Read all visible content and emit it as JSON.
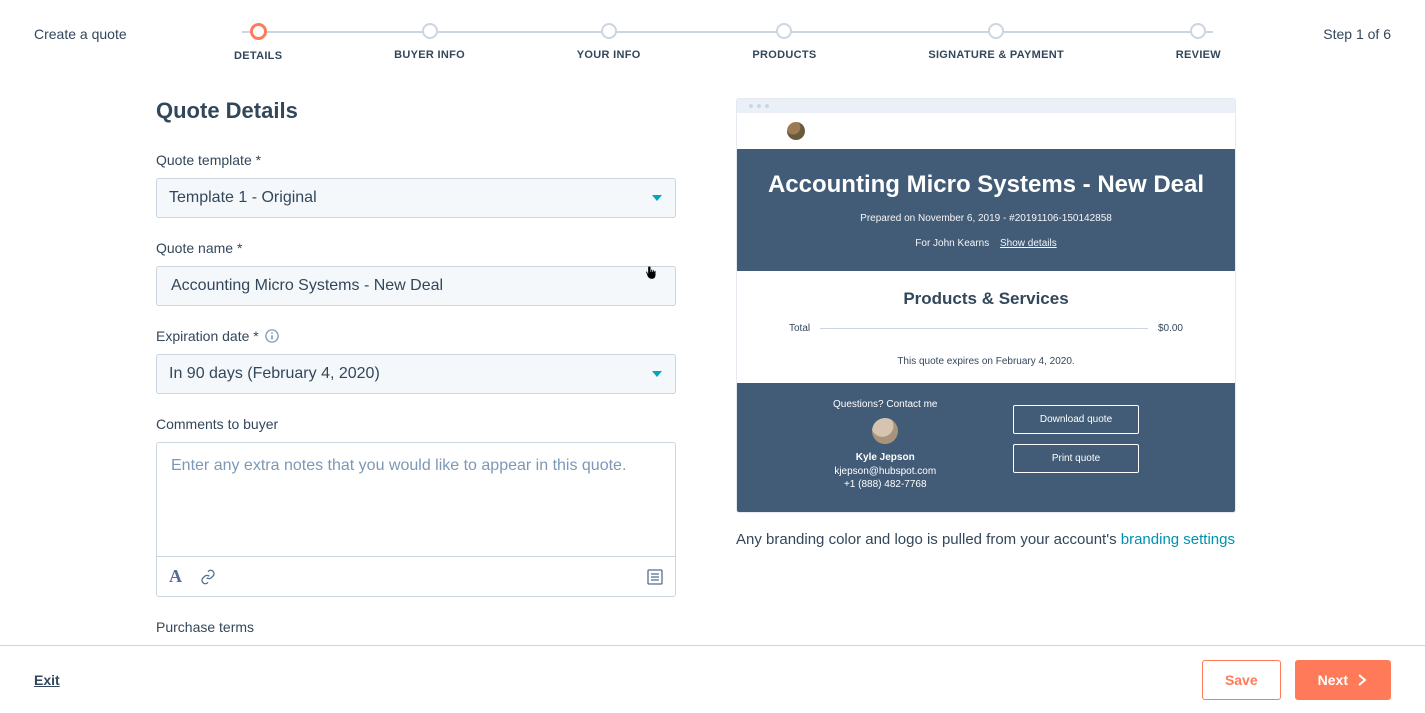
{
  "header": {
    "title": "Create a quote",
    "step_indicator": "Step 1 of 6",
    "steps": [
      {
        "label": "DETAILS",
        "active": true
      },
      {
        "label": "BUYER INFO",
        "active": false
      },
      {
        "label": "YOUR INFO",
        "active": false
      },
      {
        "label": "PRODUCTS",
        "active": false
      },
      {
        "label": "SIGNATURE & PAYMENT",
        "active": false
      },
      {
        "label": "REVIEW",
        "active": false
      }
    ]
  },
  "form": {
    "section_title": "Quote Details",
    "template_label": "Quote template *",
    "template_value": "Template 1 - Original",
    "name_label": "Quote name *",
    "name_value": "Accounting Micro Systems - New Deal",
    "expiration_label": "Expiration date *",
    "expiration_value": "In 90 days (February 4, 2020)",
    "comments_label": "Comments to buyer",
    "comments_placeholder": "Enter any extra notes that you would like to appear in this quote.",
    "purchase_terms_label": "Purchase terms"
  },
  "preview": {
    "title": "Accounting Micro Systems - New Deal",
    "prepared": "Prepared on November 6, 2019 - #20191106-150142858",
    "for_person": "For John Kearns",
    "show_details": "Show details",
    "products_heading": "Products & Services",
    "total_label": "Total",
    "total_value": "$0.00",
    "expires": "This quote expires on February 4, 2020.",
    "contact_heading": "Questions? Contact me",
    "contact_name": "Kyle Jepson",
    "contact_email": "kjepson@hubspot.com",
    "contact_phone": "+1 (888) 482-7768",
    "download_btn": "Download quote",
    "print_btn": "Print quote",
    "branding_note_prefix": "Any branding color and logo is pulled from your account's ",
    "branding_link": "branding settings"
  },
  "footer": {
    "exit": "Exit",
    "save": "Save",
    "next": "Next"
  }
}
